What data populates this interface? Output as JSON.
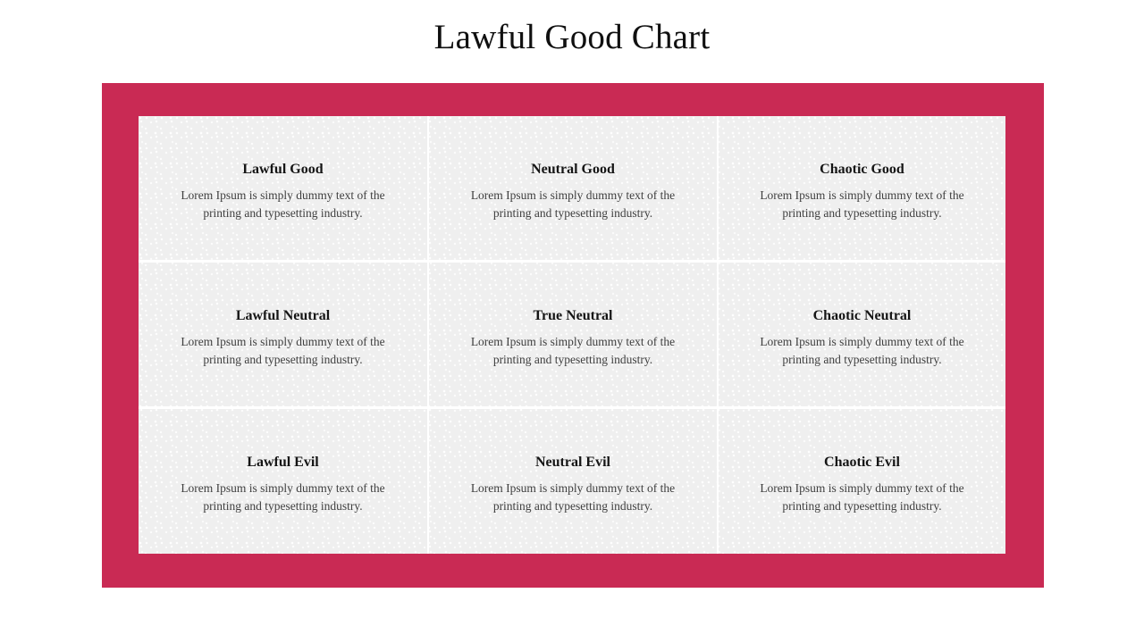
{
  "slide": {
    "title": "Lawful Good Chart",
    "frame_color": "#c92a54",
    "panel_color": "#efefef",
    "title_color": "#101010",
    "cell_title_color": "#151515",
    "cell_body_color": "#3f3f3f"
  },
  "grid": {
    "columns": 3,
    "rows": 3,
    "cells": [
      {
        "title": "Lawful Good",
        "body": "Lorem Ipsum is simply dummy text of the printing and typesetting industry."
      },
      {
        "title": "Neutral Good",
        "body": "Lorem Ipsum is simply dummy text of the printing and typesetting industry."
      },
      {
        "title": "Chaotic Good",
        "body": "Lorem Ipsum is simply dummy text of the printing and typesetting industry."
      },
      {
        "title": "Lawful Neutral",
        "body": "Lorem Ipsum is simply dummy text of the printing and typesetting industry."
      },
      {
        "title": "True Neutral",
        "body": "Lorem Ipsum is simply dummy text of the printing and typesetting industry."
      },
      {
        "title": "Chaotic Neutral",
        "body": "Lorem Ipsum is simply dummy text of the printing and typesetting industry."
      },
      {
        "title": "Lawful Evil",
        "body": "Lorem Ipsum is simply dummy text of the printing and typesetting industry."
      },
      {
        "title": "Neutral Evil",
        "body": "Lorem Ipsum is simply dummy text of the printing and typesetting industry."
      },
      {
        "title": "Chaotic Evil",
        "body": "Lorem Ipsum is simply dummy text of the printing and typesetting industry."
      }
    ]
  }
}
